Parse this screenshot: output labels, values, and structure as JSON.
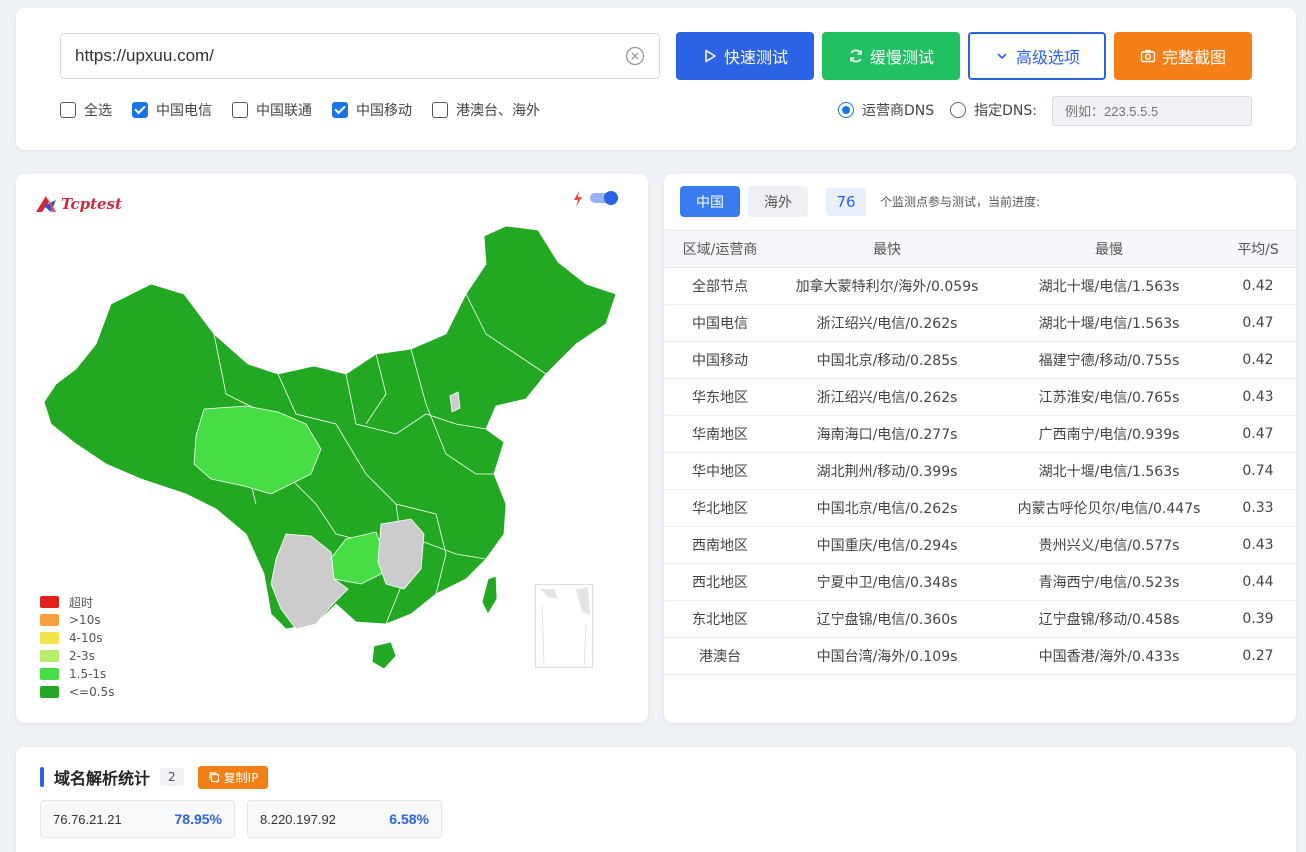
{
  "search": {
    "url": "https://upxuu.com/"
  },
  "buttons": {
    "fast": "快速测试",
    "slow": "缓慢测试",
    "advanced": "高级选项",
    "screenshot": "完整截图"
  },
  "filters": [
    {
      "label": "全选",
      "checked": false
    },
    {
      "label": "中国电信",
      "checked": true
    },
    {
      "label": "中国联通",
      "checked": false
    },
    {
      "label": "中国移动",
      "checked": true
    },
    {
      "label": "港澳台、海外",
      "checked": false
    }
  ],
  "dns": {
    "option_isp": "运营商DNS",
    "option_custom": "指定DNS:",
    "placeholder": "例如：223.5.5.5",
    "selected": "运营商DNS"
  },
  "map": {
    "logo": "Tcptest",
    "legend": [
      {
        "label": "超时",
        "color": "#e0201b"
      },
      {
        "label": ">10s",
        "color": "#f5a03a"
      },
      {
        "label": "4-10s",
        "color": "#f2e44a"
      },
      {
        "label": "2-3s",
        "color": "#b7ec6a"
      },
      {
        "label": "1.5-1s",
        "color": "#47dd45"
      },
      {
        "label": "<=0.5s",
        "color": "#22a822"
      }
    ]
  },
  "results": {
    "tabs": [
      "中国",
      "海外"
    ],
    "active_tab": "中国",
    "node_count": "76",
    "count_text": "个监测点参与测试，当前进度:",
    "headers": [
      "区域/运营商",
      "最快",
      "最慢",
      "平均/S"
    ],
    "rows": [
      [
        "全部节点",
        "加拿大蒙特利尔/海外/0.059s",
        "湖北十堰/电信/1.563s",
        "0.42"
      ],
      [
        "中国电信",
        "浙江绍兴/电信/0.262s",
        "湖北十堰/电信/1.563s",
        "0.47"
      ],
      [
        "中国移动",
        "中国北京/移动/0.285s",
        "福建宁德/移动/0.755s",
        "0.42"
      ],
      [
        "华东地区",
        "浙江绍兴/电信/0.262s",
        "江苏淮安/电信/0.765s",
        "0.43"
      ],
      [
        "华南地区",
        "海南海口/电信/0.277s",
        "广西南宁/电信/0.939s",
        "0.47"
      ],
      [
        "华中地区",
        "湖北荆州/移动/0.399s",
        "湖北十堰/电信/1.563s",
        "0.74"
      ],
      [
        "华北地区",
        "中国北京/电信/0.262s",
        "内蒙古呼伦贝尔/电信/0.447s",
        "0.33"
      ],
      [
        "西南地区",
        "中国重庆/电信/0.294s",
        "贵州兴义/电信/0.577s",
        "0.43"
      ],
      [
        "西北地区",
        "宁夏中卫/电信/0.348s",
        "青海西宁/电信/0.523s",
        "0.44"
      ],
      [
        "东北地区",
        "辽宁盘锦/电信/0.360s",
        "辽宁盘锦/移动/0.458s",
        "0.39"
      ],
      [
        "港澳台",
        "中国台湾/海外/0.109s",
        "中国香港/海外/0.433s",
        "0.27"
      ]
    ]
  },
  "dns_stats": {
    "title": "域名解析统计",
    "count": "2",
    "copy_label": "复制IP",
    "ips": [
      {
        "ip": "76.76.21.21",
        "pct": "78.95%"
      },
      {
        "ip": "8.220.197.92",
        "pct": "6.58%"
      }
    ]
  }
}
